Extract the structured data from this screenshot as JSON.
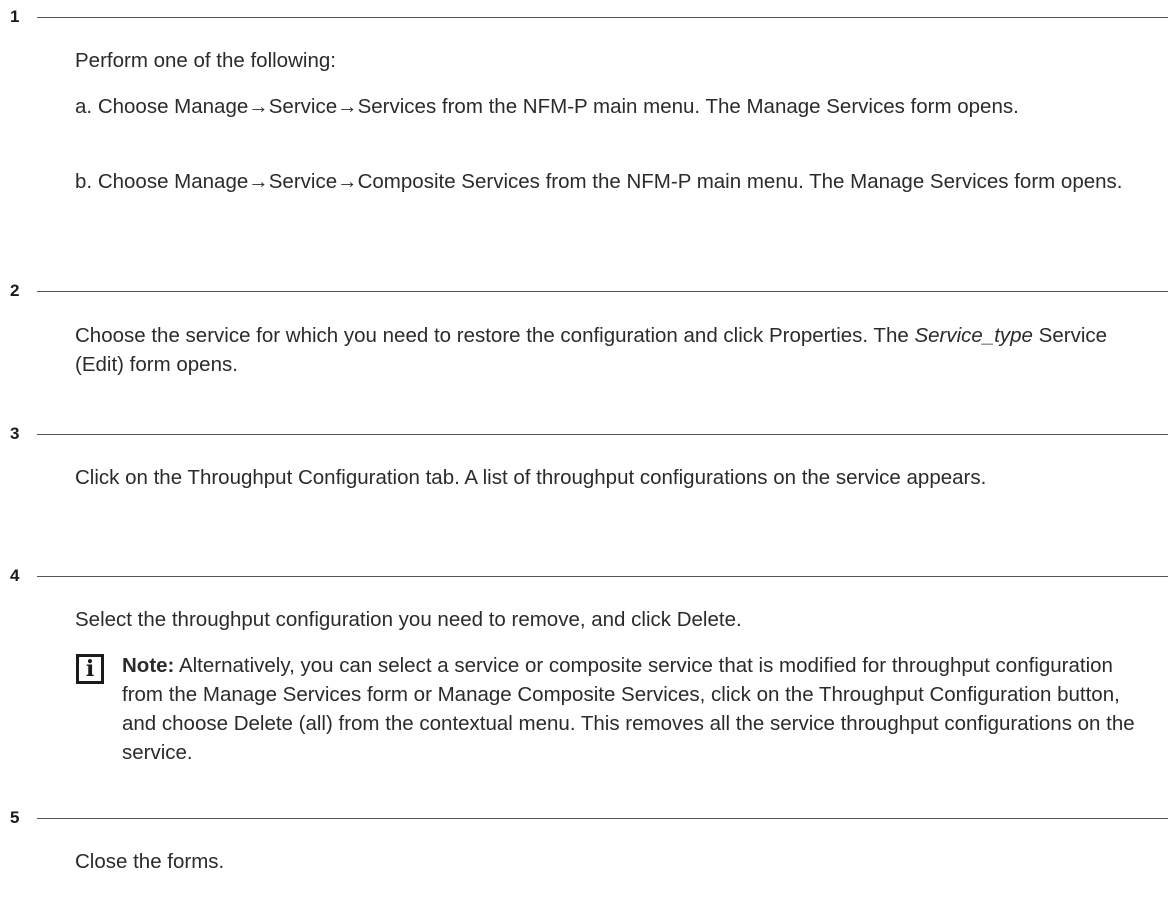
{
  "steps": [
    {
      "number": "1",
      "intro": "Perform one of the following:",
      "items": [
        {
          "marker": "a.",
          "text": "Choose Manage→Service→Services from the NFM-P main menu. The Manage Services form opens."
        },
        {
          "marker": "b.",
          "text": "Choose Manage→Service→Composite Services from the NFM-P main menu. The Manage Services form opens."
        }
      ]
    },
    {
      "number": "2",
      "text_italic": "Service_type",
      "text_before": "Choose the service for which you need to restore the configuration and click Properties. The ",
      "text_after": " Service (Edit) form opens."
    },
    {
      "number": "3",
      "text": "Click on the Throughput Configuration tab. A list of throughput configurations on the service appears."
    },
    {
      "number": "4",
      "text": "Select the throughput configuration you need to remove, and click Delete.",
      "note": {
        "icon": "info-icon",
        "label": "Note:",
        "text": " Alternatively, you can select a service or composite service that is modified for throughput configuration from the Manage Services form or Manage Composite Services, click on the Throughput Configuration button, and choose Delete (all) from the contextual menu. This removes all the service throughput configurations on the service."
      }
    },
    {
      "number": "5",
      "text": "Close the forms."
    }
  ]
}
